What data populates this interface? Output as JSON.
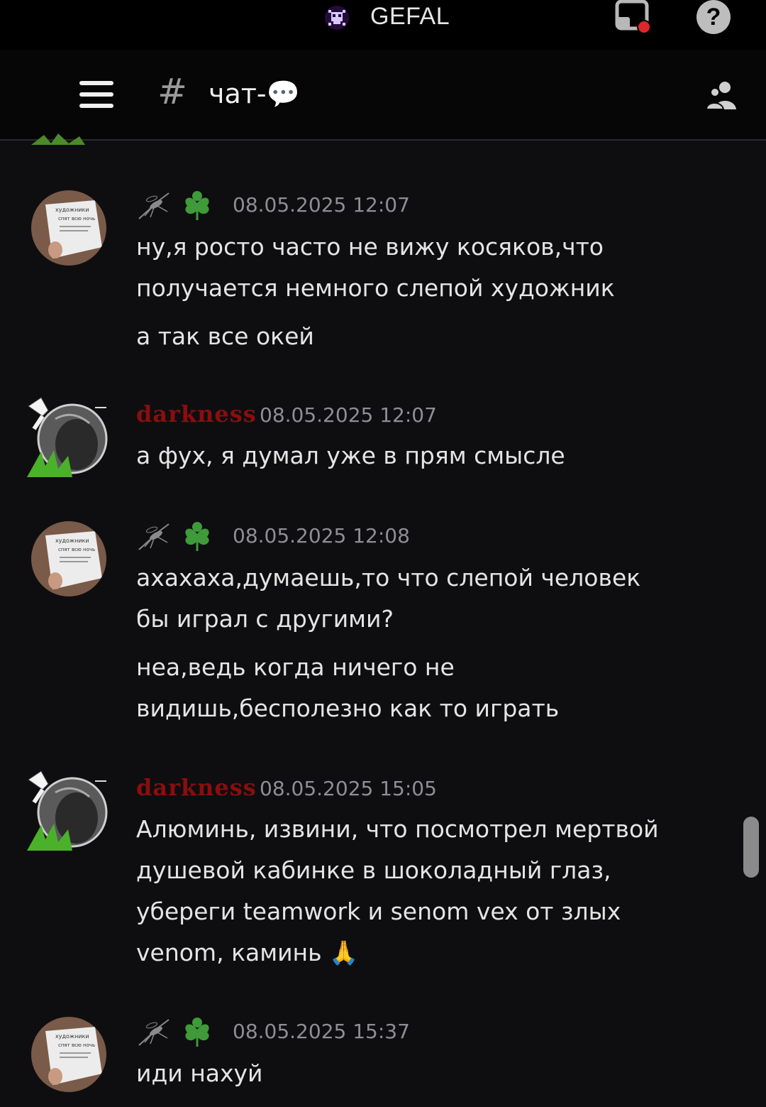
{
  "app": {
    "title": "GEFAL",
    "logo_icon": "pixel-skull-icon",
    "screen_icon": "screen-share-icon",
    "help_label": "?"
  },
  "channel": {
    "hash": "#",
    "name": "чат-💬",
    "menu_icon": "hamburger-menu-icon",
    "members_icon": "members-icon"
  },
  "messages": [
    {
      "author": "",
      "author_badges": [
        "mosquito-icon",
        "clover-icon"
      ],
      "timestamp": "08.05.2025 12:07",
      "lines": [
        "ну,я росто часто не вижу косяков,что",
        "получается немного слепой художник"
      ],
      "extra": [
        "а так все окей"
      ]
    },
    {
      "author": "darkness",
      "timestamp": "08.05.2025 12:07",
      "lines": [
        "а фух, я думал уже в прям смысле"
      ]
    },
    {
      "author": "",
      "author_badges": [
        "mosquito-icon",
        "clover-icon"
      ],
      "timestamp": "08.05.2025 12:08",
      "lines": [
        "ахахаха,думаешь,то что слепой человек",
        "бы играл с другими?"
      ],
      "extra": [
        "неа,ведь когда ничего не",
        "видишь,бесполезно как то играть"
      ]
    },
    {
      "author": "darkness",
      "timestamp": "08.05.2025 15:05",
      "lines": [
        "Алюминь, извини, что посмотрел мертвой",
        "душевой кабинке в шоколадный глаз,",
        "убереги teamwork и senom vex от злых",
        "venom, каминь 🙏"
      ]
    },
    {
      "author": "",
      "author_badges": [
        "mosquito-icon",
        "clover-icon"
      ],
      "timestamp": "08.05.2025 15:37",
      "lines": [
        "иди нахуй"
      ]
    }
  ],
  "colors": {
    "background": "#0e0e10",
    "username_red": "#8a0e0e",
    "clover_green": "#3f9a3a",
    "timestamp_gray": "#8e8e93"
  }
}
